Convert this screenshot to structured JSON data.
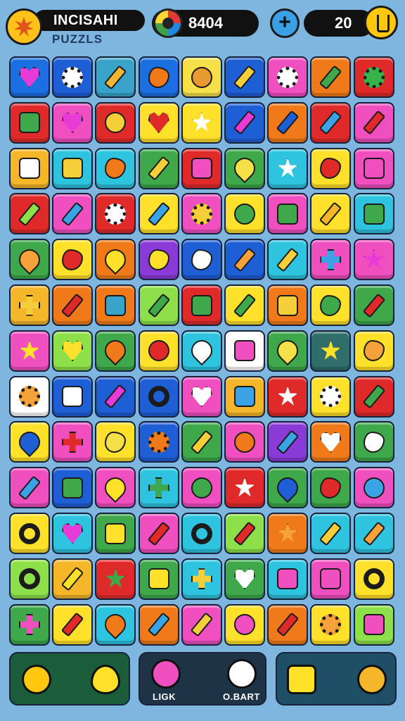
{
  "hud": {
    "title": "INCISAHI",
    "subtitle": "PUZZLS",
    "score": "8404",
    "plus_label": "+",
    "coins": "20"
  },
  "board": {
    "cols": 9,
    "rows": 13,
    "tiles": [
      [
        "#1b6fe0",
        "heart",
        "#e83ad6"
      ],
      [
        "#1f5fd6",
        "gear",
        "#ffffff"
      ],
      [
        "#3aa3c9",
        "pencil",
        "#f2b632"
      ],
      [
        "#1b6fe0",
        "blob",
        "#f07a1a"
      ],
      [
        "#f5e04a",
        "circle",
        "#e89a2e"
      ],
      [
        "#1f5fd6",
        "pencil",
        "#f5cf3a"
      ],
      [
        "#f04fc0",
        "gear",
        "#ffffff"
      ],
      [
        "#f07a1a",
        "pencil",
        "#3ea84a"
      ],
      [
        "#e02a2a",
        "gear",
        "#36b34a"
      ],
      [
        "#e02a2a",
        "square",
        "#3ea84a"
      ],
      [
        "#f04fc0",
        "heart",
        "#e83ad6"
      ],
      [
        "#e02a2a",
        "circle",
        "#f5cf3a"
      ],
      [
        "#ffe02a",
        "heart",
        "#e02a2a"
      ],
      [
        "#ffe02a",
        "star",
        "#ffffff"
      ],
      [
        "#1f5fd6",
        "pencil",
        "#e83ad6"
      ],
      [
        "#f07a1a",
        "pencil",
        "#1f5fd6"
      ],
      [
        "#e02a2a",
        "pencil",
        "#3aa3e6"
      ],
      [
        "#f04fc0",
        "pencil",
        "#e02a2a"
      ],
      [
        "#f5b62a",
        "square",
        "#ffffff"
      ],
      [
        "#2ec4e0",
        "square",
        "#f5cf3a"
      ],
      [
        "#2ec4e0",
        "blob",
        "#f07a1a"
      ],
      [
        "#3ea84a",
        "pencil",
        "#f5cf3a"
      ],
      [
        "#e02a2a",
        "square",
        "#f04fc0"
      ],
      [
        "#3ea84a",
        "drop",
        "#f5e04a"
      ],
      [
        "#2ec4e0",
        "star",
        "#ffffff"
      ],
      [
        "#ffe02a",
        "blob",
        "#e02a2a"
      ],
      [
        "#f04fc0",
        "square",
        "#f04fc0"
      ],
      [
        "#e02a2a",
        "pencil",
        "#8de04a"
      ],
      [
        "#f04fc0",
        "pencil",
        "#3aa3e6"
      ],
      [
        "#e02a2a",
        "gear",
        "#ffffff"
      ],
      [
        "#ffe02a",
        "pencil",
        "#3aa3e6"
      ],
      [
        "#f04fc0",
        "gear",
        "#f5cf3a"
      ],
      [
        "#ffe02a",
        "circle",
        "#3ea84a"
      ],
      [
        "#f04fc0",
        "square",
        "#3ea84a"
      ],
      [
        "#ffe02a",
        "pencil",
        "#f5b62a"
      ],
      [
        "#2ec4e0",
        "square",
        "#3ea84a"
      ],
      [
        "#3ea84a",
        "drop",
        "#f5a23a"
      ],
      [
        "#ffe02a",
        "blob",
        "#e02a2a"
      ],
      [
        "#f07a1a",
        "drop",
        "#ffe02a"
      ],
      [
        "#8a3ad6",
        "blob",
        "#ffe02a"
      ],
      [
        "#1f5fd6",
        "blob",
        "#ffffff"
      ],
      [
        "#1f5fd6",
        "pencil",
        "#f5a23a"
      ],
      [
        "#2ec4e0",
        "pencil",
        "#f5cf3a"
      ],
      [
        "#f04fc0",
        "cross",
        "#3aa3e6"
      ],
      [
        "#f04fc0",
        "star",
        "#e83ad6"
      ],
      [
        "#f5b62a",
        "cross",
        "#f5cf3a"
      ],
      [
        "#f07a1a",
        "pencil",
        "#e02a2a"
      ],
      [
        "#f07a1a",
        "square",
        "#3aa3c9"
      ],
      [
        "#8de04a",
        "pencil",
        "#3ea84a"
      ],
      [
        "#e02a2a",
        "square",
        "#3ea84a"
      ],
      [
        "#ffe02a",
        "pencil",
        "#3ea84a"
      ],
      [
        "#f07a1a",
        "square",
        "#f5cf3a"
      ],
      [
        "#ffe02a",
        "blob",
        "#3ea84a"
      ],
      [
        "#3ea84a",
        "pencil",
        "#e02a2a"
      ],
      [
        "#f04fc0",
        "star",
        "#ffe02a"
      ],
      [
        "#8de04a",
        "heart",
        "#ffe02a"
      ],
      [
        "#3ea84a",
        "drop",
        "#f07a1a"
      ],
      [
        "#ffe02a",
        "circle",
        "#e02a2a"
      ],
      [
        "#2ec4e0",
        "drop",
        "#ffffff"
      ],
      [
        "#ffffff",
        "square",
        "#f04fc0"
      ],
      [
        "#3ea84a",
        "drop",
        "#f5e04a"
      ],
      [
        "#2f6e6a",
        "star",
        "#ffe02a"
      ],
      [
        "#ffe02a",
        "blob",
        "#f5a23a"
      ],
      [
        "#ffffff",
        "gear",
        "#f5a23a"
      ],
      [
        "#1f5fd6",
        "square",
        "#ffffff"
      ],
      [
        "#1f5fd6",
        "pencil",
        "#e83ad6"
      ],
      [
        "#1f5fd6",
        "ring",
        "#ffe02a"
      ],
      [
        "#f04fc0",
        "heart",
        "#ffffff"
      ],
      [
        "#f5b62a",
        "square",
        "#3aa3e6"
      ],
      [
        "#e02a2a",
        "star",
        "#ffffff"
      ],
      [
        "#ffe02a",
        "gear",
        "#ffffff"
      ],
      [
        "#e02a2a",
        "pencil",
        "#3ea84a"
      ],
      [
        "#ffe02a",
        "drop",
        "#1f5fd6"
      ],
      [
        "#f04fc0",
        "cross",
        "#e02a2a"
      ],
      [
        "#ffe02a",
        "blob",
        "#f5e04a"
      ],
      [
        "#1f5fd6",
        "gear",
        "#f07a1a"
      ],
      [
        "#3ea84a",
        "pencil",
        "#f5cf3a"
      ],
      [
        "#f04fc0",
        "circle",
        "#f07a1a"
      ],
      [
        "#8a3ad6",
        "pencil",
        "#3aa3e6"
      ],
      [
        "#f07a1a",
        "heart",
        "#ffffff"
      ],
      [
        "#3ea84a",
        "blob",
        "#ffffff"
      ],
      [
        "#f04fc0",
        "pencil",
        "#3aa3e6"
      ],
      [
        "#1f5fd6",
        "square",
        "#3ea84a"
      ],
      [
        "#f04fc0",
        "drop",
        "#ffe02a"
      ],
      [
        "#2ec4e0",
        "cross",
        "#3ea84a"
      ],
      [
        "#f04fc0",
        "circle",
        "#3ea84a"
      ],
      [
        "#e02a2a",
        "star",
        "#ffffff"
      ],
      [
        "#3ea84a",
        "drop",
        "#1f5fd6"
      ],
      [
        "#3ea84a",
        "blob",
        "#e02a2a"
      ],
      [
        "#f04fc0",
        "circle",
        "#3aa3e6"
      ],
      [
        "#ffe02a",
        "ring",
        "#ffffff"
      ],
      [
        "#2ec4e0",
        "heart",
        "#e83ad6"
      ],
      [
        "#3ea84a",
        "square",
        "#ffe02a"
      ],
      [
        "#f04fc0",
        "pencil",
        "#e02a2a"
      ],
      [
        "#2ec4e0",
        "ring",
        "#f04fc0"
      ],
      [
        "#8de04a",
        "pencil",
        "#e02a2a"
      ],
      [
        "#f07a1a",
        "star",
        "#f5a23a"
      ],
      [
        "#2ec4e0",
        "pencil",
        "#f5cf3a"
      ],
      [
        "#2ec4e0",
        "pencil",
        "#f5a23a"
      ],
      [
        "#8de04a",
        "ring",
        "#f04fc0"
      ],
      [
        "#f5b62a",
        "pencil",
        "#ffe02a"
      ],
      [
        "#e02a2a",
        "star",
        "#3ea84a"
      ],
      [
        "#3ea84a",
        "square",
        "#ffe02a"
      ],
      [
        "#2ec4e0",
        "cross",
        "#f5cf3a"
      ],
      [
        "#3ea84a",
        "heart",
        "#ffffff"
      ],
      [
        "#2ec4e0",
        "square",
        "#f04fc0"
      ],
      [
        "#f04fc0",
        "square",
        "#f04fc0"
      ],
      [
        "#ffe02a",
        "ring",
        "#f04fc0"
      ],
      [
        "#3ea84a",
        "cross",
        "#f04fc0"
      ],
      [
        "#ffe02a",
        "pencil",
        "#e02a2a"
      ],
      [
        "#2ec4e0",
        "drop",
        "#f07a1a"
      ],
      [
        "#f07a1a",
        "pencil",
        "#3aa3e6"
      ],
      [
        "#f04fc0",
        "pencil",
        "#f5cf3a"
      ],
      [
        "#ffe02a",
        "circle",
        "#f04fc0"
      ],
      [
        "#f07a1a",
        "pencil",
        "#e02a2a"
      ],
      [
        "#ffe02a",
        "gear",
        "#f5a23a"
      ],
      [
        "#8de04a",
        "square",
        "#f04fc0"
      ]
    ]
  },
  "bottom": {
    "left_label": "",
    "middle_left_label": "LIGK",
    "middle_right_label": "O.BART",
    "right_label": ""
  }
}
